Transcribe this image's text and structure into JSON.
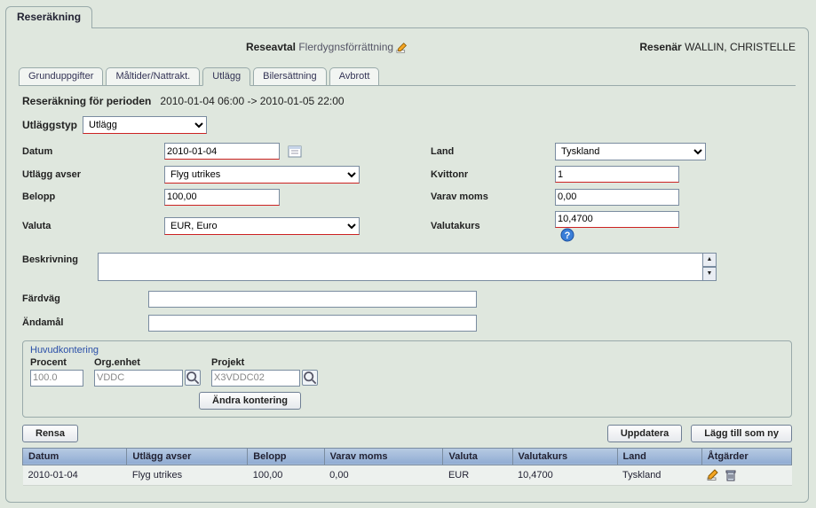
{
  "outer_tab": "Reseräkning",
  "top": {
    "contract_label": "Reseavtal",
    "contract_value": "Flerdygnsförrättning",
    "traveler_label": "Resenär",
    "traveler_name": "WALLIN, CHRISTELLE"
  },
  "tabs": [
    {
      "label": "Grunduppgifter"
    },
    {
      "label": "Måltider/Nattrakt."
    },
    {
      "label": "Utlägg"
    },
    {
      "label": "Bilersättning"
    },
    {
      "label": "Avbrott"
    }
  ],
  "period": {
    "label": "Reseräkning för perioden",
    "value": "2010-01-04 06:00 -> 2010-01-05 22:00"
  },
  "type": {
    "label": "Utläggstyp",
    "value": "Utlägg"
  },
  "form": {
    "date_label": "Datum",
    "date_value": "2010-01-04",
    "utlagg_avser_label": "Utlägg avser",
    "utlagg_avser_value": "Flyg utrikes",
    "belopp_label": "Belopp",
    "belopp_value": "100,00",
    "valuta_label": "Valuta",
    "valuta_value": "EUR, Euro",
    "land_label": "Land",
    "land_value": "Tyskland",
    "kvittonr_label": "Kvittonr",
    "kvittonr_value": "1",
    "moms_label": "Varav moms",
    "moms_value": "0,00",
    "valutakurs_label": "Valutakurs",
    "valutakurs_value": "10,4700",
    "beskrivning_label": "Beskrivning",
    "beskrivning_value": "",
    "fardvag_label": "Färdväg",
    "fardvag_value": "",
    "andamal_label": "Ändamål",
    "andamal_value": ""
  },
  "kontering": {
    "title": "Huvudkontering",
    "procent_label": "Procent",
    "procent_value": "100.0",
    "orgenhet_label": "Org.enhet",
    "orgenhet_value": "VDDC",
    "projekt_label": "Projekt",
    "projekt_value": "X3VDDC02",
    "edit_btn": "Ändra kontering"
  },
  "buttons": {
    "clear": "Rensa",
    "update": "Uppdatera",
    "add_new": "Lägg till som ny"
  },
  "table": {
    "headers": {
      "datum": "Datum",
      "utlagg_avser": "Utlägg avser",
      "belopp": "Belopp",
      "moms": "Varav moms",
      "valuta": "Valuta",
      "valutakurs": "Valutakurs",
      "land": "Land",
      "atgarder": "Åtgärder"
    },
    "rows": [
      {
        "datum": "2010-01-04",
        "utlagg_avser": "Flyg utrikes",
        "belopp": "100,00",
        "moms": "0,00",
        "valuta": "EUR",
        "valutakurs": "10,4700",
        "land": "Tyskland"
      }
    ]
  }
}
